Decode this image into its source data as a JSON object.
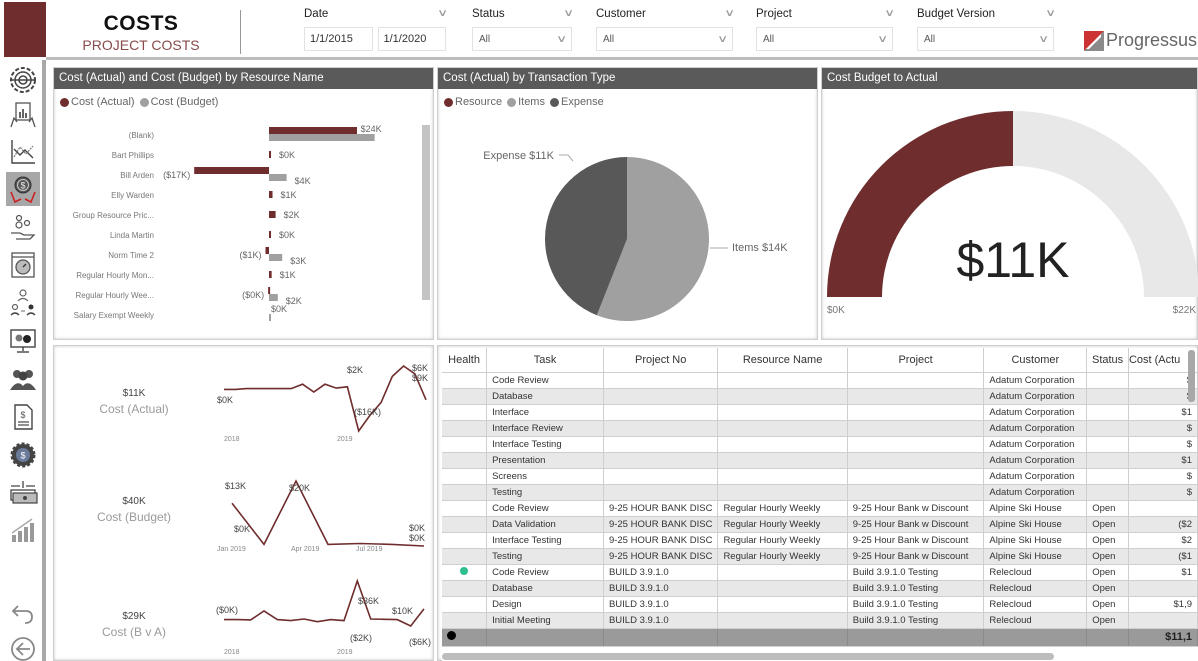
{
  "header": {
    "title": "COSTS",
    "subtitle": "PROJECT COSTS",
    "brand_color": "#6f2d2d",
    "logo_text": "Progressus"
  },
  "filters": {
    "date": {
      "label": "Date",
      "from": "1/1/2015",
      "to": "1/1/2020"
    },
    "status": {
      "label": "Status",
      "value": "All"
    },
    "customer": {
      "label": "Customer",
      "value": "All"
    },
    "project": {
      "label": "Project",
      "value": "All"
    },
    "budget_version": {
      "label": "Budget Version",
      "value": "All"
    }
  },
  "sidebar": {
    "items": [
      {
        "icon": "gear-target-icon",
        "active": false
      },
      {
        "icon": "report-hands-icon",
        "active": false
      },
      {
        "icon": "line-chart-icon",
        "active": false
      },
      {
        "icon": "dollar-hands-icon",
        "active": true
      },
      {
        "icon": "coins-hand-icon",
        "active": false
      },
      {
        "icon": "stopwatch-window-icon",
        "active": false
      },
      {
        "icon": "org-people-icon",
        "active": false
      },
      {
        "icon": "monitor-gears-icon",
        "active": false
      },
      {
        "icon": "people-group-icon",
        "active": false
      },
      {
        "icon": "invoice-document-icon",
        "active": false
      },
      {
        "icon": "dollar-gear-icon",
        "active": false
      },
      {
        "icon": "cash-stack-icon",
        "active": false
      },
      {
        "icon": "growth-chart-icon",
        "active": false
      }
    ],
    "undo_icon": "undo-icon",
    "back_icon": "back-arrow-icon"
  },
  "colors": {
    "actual": "#6f2d2d",
    "budget": "#a0a0a0",
    "expense": "#585858",
    "gauge_track": "#e8e8e8",
    "health_good": "#2fbf8f"
  },
  "chart_data": [
    {
      "type": "bar",
      "title": "Cost (Actual) and Cost (Budget) by Resource Name",
      "legend": [
        "Cost (Actual)",
        "Cost (Budget)"
      ],
      "legend_position": "top-left",
      "categories": [
        "(Blank)",
        "Bart Phillips",
        "Bill Arden",
        "Elly Warden",
        "Group Resource Pric...",
        "Linda Martin",
        "Norm Time 2",
        "Regular Hourly Mon...",
        "Regular Hourly Wee...",
        "Salary Exempt Weekly"
      ],
      "series": [
        {
          "name": "Cost (Actual)",
          "values": [
            20,
            0.2,
            -17,
            0.8,
            1.5,
            0.2,
            -0.8,
            0.6,
            -0.2,
            0
          ]
        },
        {
          "name": "Cost (Budget)",
          "values": [
            24,
            0,
            4,
            0,
            0,
            0,
            3,
            0,
            2,
            0.2
          ]
        }
      ],
      "data_labels": [
        "$24K",
        "$0K",
        "($17K)",
        "$4K",
        "$1K",
        "$2K",
        "$0K",
        "($1K)",
        "$3K",
        "$1K",
        "($0K)",
        "$2K",
        "$0K"
      ],
      "orientation": "horizontal"
    },
    {
      "type": "pie",
      "title": "Cost (Actual) by Transaction Type",
      "legend": [
        "Resource",
        "Items",
        "Expense"
      ],
      "legend_position": "top-left",
      "slices": [
        {
          "label": "Items",
          "value": 14,
          "display": "Items $14K"
        },
        {
          "label": "Expense",
          "value": 11,
          "display": "Expense $11K"
        }
      ]
    },
    {
      "type": "gauge",
      "title": "Cost Budget to Actual",
      "value": 11,
      "min": 0,
      "max": 22,
      "value_label": "$11K",
      "min_label": "$0K",
      "max_label": "$22K"
    },
    {
      "type": "line",
      "title": "Cost (Actual)",
      "kpi_value": "$11K",
      "x_ticks": [
        "2018",
        "2019"
      ],
      "points": [
        0,
        0,
        0.3,
        0.3,
        0.3,
        0.3,
        0.3,
        2,
        -1,
        2,
        0.5,
        1,
        -16,
        -10,
        -5,
        5,
        9,
        6,
        -4
      ],
      "labels": [
        "$0K",
        "$2K",
        "($16K)",
        "$6K",
        "$9K"
      ]
    },
    {
      "type": "line",
      "title": "Cost (Budget)",
      "kpi_value": "$40K",
      "x_ticks": [
        "Jan 2019",
        "Apr 2019",
        "Jul 2019"
      ],
      "points": [
        13,
        0,
        20,
        0,
        0.3,
        0,
        -0.5
      ],
      "labels": [
        "$13K",
        "$0K",
        "$20K",
        "$0K",
        "$0K"
      ]
    },
    {
      "type": "line",
      "title": "Cost (B v A)",
      "kpi_value": "$29K",
      "x_ticks": [
        "2018",
        "2019"
      ],
      "points": [
        0,
        0,
        -0.3,
        8,
        0,
        -1,
        0.5,
        -2,
        0,
        -1,
        36,
        0.5,
        0.3,
        0,
        -6,
        10
      ],
      "labels": [
        "($0K)",
        "$36K",
        "($2K)",
        "$10K",
        "($6K)"
      ]
    }
  ],
  "table": {
    "columns": [
      "Health",
      "Task",
      "Project No",
      "Resource Name",
      "Project",
      "Customer",
      "Status",
      "Cost (Actu"
    ],
    "rows": [
      [
        "",
        "Code Review",
        "",
        "",
        "",
        "Adatum Corporation",
        "",
        "$"
      ],
      [
        "",
        "Database",
        "",
        "",
        "",
        "Adatum Corporation",
        "",
        "$"
      ],
      [
        "",
        "Interface",
        "",
        "",
        "",
        "Adatum Corporation",
        "",
        "$1"
      ],
      [
        "",
        "Interface Review",
        "",
        "",
        "",
        "Adatum Corporation",
        "",
        "$"
      ],
      [
        "",
        "Interface Testing",
        "",
        "",
        "",
        "Adatum Corporation",
        "",
        "$"
      ],
      [
        "",
        "Presentation",
        "",
        "",
        "",
        "Adatum Corporation",
        "",
        "$1"
      ],
      [
        "",
        "Screens",
        "",
        "",
        "",
        "Adatum Corporation",
        "",
        "$"
      ],
      [
        "",
        "Testing",
        "",
        "",
        "",
        "Adatum Corporation",
        "",
        "$"
      ],
      [
        "",
        "Code Review",
        "9-25 HOUR BANK DISC",
        "Regular Hourly Weekly",
        "9-25 Hour Bank w Discount",
        "Alpine Ski House",
        "Open",
        ""
      ],
      [
        "",
        "Data Validation",
        "9-25 HOUR BANK DISC",
        "Regular Hourly Weekly",
        "9-25 Hour Bank w Discount",
        "Alpine Ski House",
        "Open",
        "($2"
      ],
      [
        "",
        "Interface Testing",
        "9-25 HOUR BANK DISC",
        "Regular Hourly Weekly",
        "9-25 Hour Bank w Discount",
        "Alpine Ski House",
        "Open",
        "$2"
      ],
      [
        "",
        "Testing",
        "9-25 HOUR BANK DISC",
        "Regular Hourly Weekly",
        "9-25 Hour Bank w Discount",
        "Alpine Ski House",
        "Open",
        "($1"
      ],
      [
        "good",
        "Code Review",
        "BUILD 3.9.1.0",
        "",
        "Build 3.9.1.0 Testing",
        "Relecloud",
        "Open",
        "$1"
      ],
      [
        "",
        "Database",
        "BUILD 3.9.1.0",
        "",
        "Build 3.9.1.0 Testing",
        "Relecloud",
        "Open",
        ""
      ],
      [
        "",
        "Design",
        "BUILD 3.9.1.0",
        "",
        "Build 3.9.1.0 Testing",
        "Relecloud",
        "Open",
        "$1,9"
      ],
      [
        "",
        "Initial Meeting",
        "BUILD 3.9.1.0",
        "",
        "Build 3.9.1.0 Testing",
        "Relecloud",
        "Open",
        ""
      ]
    ],
    "total_label": "$11,1"
  }
}
